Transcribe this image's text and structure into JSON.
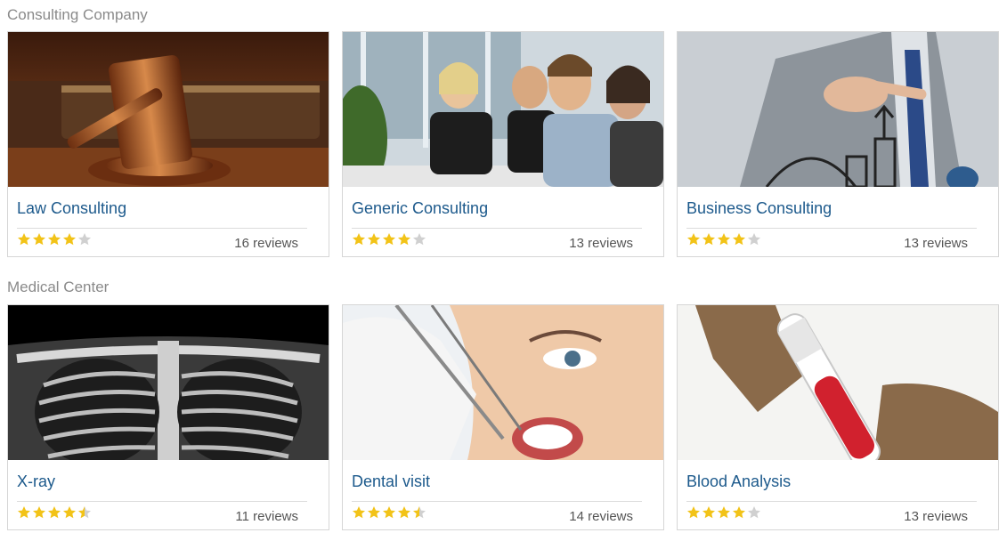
{
  "sections": [
    {
      "title": "Consulting Company",
      "cards": [
        {
          "title": "Law Consulting",
          "rating": 4,
          "reviews": "16 reviews",
          "image": "gavel-book"
        },
        {
          "title": "Generic Consulting",
          "rating": 4,
          "reviews": "13 reviews",
          "image": "business-meeting"
        },
        {
          "title": "Business Consulting",
          "rating": 4,
          "reviews": "13 reviews",
          "image": "growth-chart"
        }
      ]
    },
    {
      "title": "Medical Center",
      "cards": [
        {
          "title": "X-ray",
          "rating": 4.5,
          "reviews": "11 reviews",
          "image": "chest-xray"
        },
        {
          "title": "Dental visit",
          "rating": 4.5,
          "reviews": "14 reviews",
          "image": "dental-exam"
        },
        {
          "title": "Blood Analysis",
          "rating": 4,
          "reviews": "13 reviews",
          "image": "blood-test-tubes"
        }
      ]
    }
  ],
  "colors": {
    "title": "#1d5a8c",
    "star": "#f2c318",
    "star_empty": "#d0d0d0",
    "section_title": "#8a8a8a"
  }
}
